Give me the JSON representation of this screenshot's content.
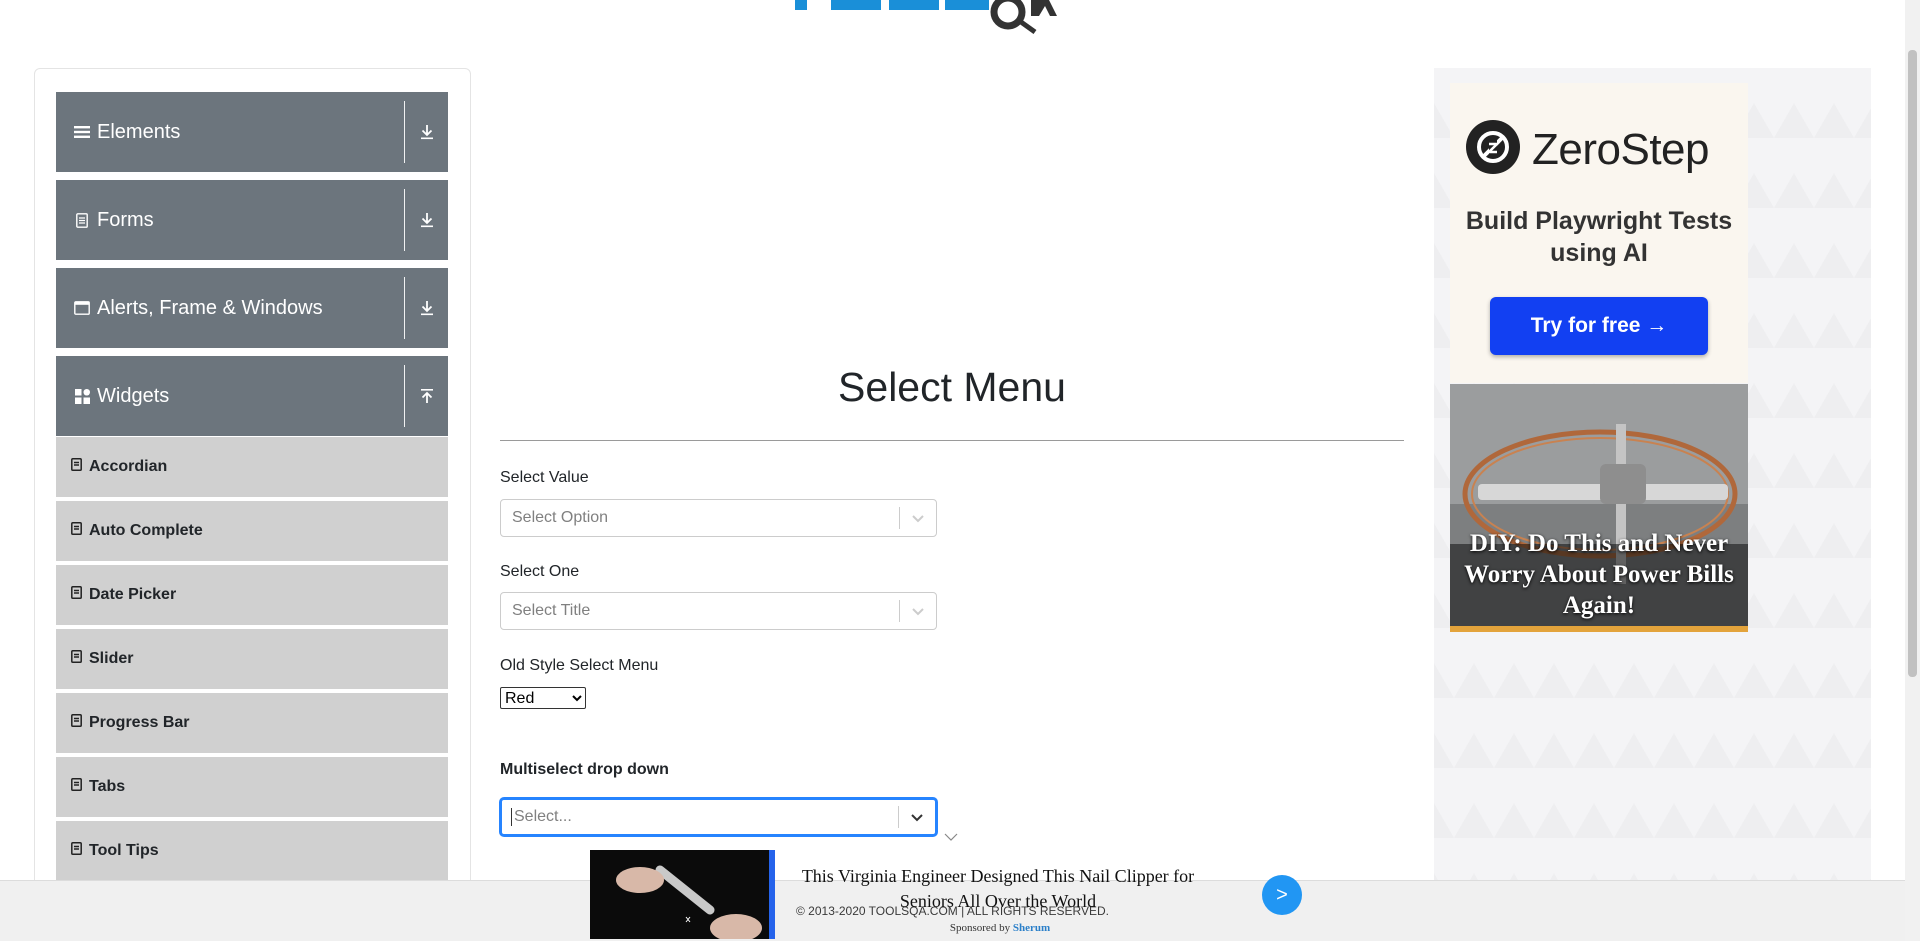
{
  "header": {
    "logo_alt": "TOOLSQA"
  },
  "sidebar": {
    "groups": [
      {
        "label": "Elements",
        "icon": "hamburger-icon",
        "toggle_icon": "download-arrow-icon"
      },
      {
        "label": "Forms",
        "icon": "document-icon",
        "toggle_icon": "download-arrow-icon"
      },
      {
        "label": "Alerts, Frame & Windows",
        "icon": "window-icon",
        "toggle_icon": "download-arrow-icon"
      },
      {
        "label": "Widgets",
        "icon": "grid-icon",
        "toggle_icon": "upload-arrow-icon"
      }
    ],
    "widget_items": [
      {
        "label": "Accordian"
      },
      {
        "label": "Auto Complete"
      },
      {
        "label": "Date Picker"
      },
      {
        "label": "Slider"
      },
      {
        "label": "Progress Bar"
      },
      {
        "label": "Tabs"
      },
      {
        "label": "Tool Tips"
      }
    ]
  },
  "main": {
    "title": "Select Menu",
    "select_value": {
      "label": "Select Value",
      "placeholder": "Select Option"
    },
    "select_one": {
      "label": "Select One",
      "placeholder": "Select Title"
    },
    "old_style": {
      "label": "Old Style Select Menu",
      "selected": "Red"
    },
    "multiselect": {
      "label": "Multiselect drop down",
      "placeholder": "Select..."
    }
  },
  "right_ad": {
    "brand": "ZeroStep",
    "tagline": "Build Playwright Tests using AI",
    "cta": "Try for free →",
    "diy_headline": "DIY: Do This and Never Worry About Power Bills Again!"
  },
  "bottom_ad": {
    "headline": "This Virginia Engineer Designed This Nail Clipper for Seniors All Over the World",
    "sponsor_prefix": "Sponsored by",
    "sponsor_name": "Sherum",
    "next": ">"
  },
  "footer": {
    "copyright": "© 2013-2020 TOOLSQA.COM | ALL RIGHTS RESERVED."
  }
}
